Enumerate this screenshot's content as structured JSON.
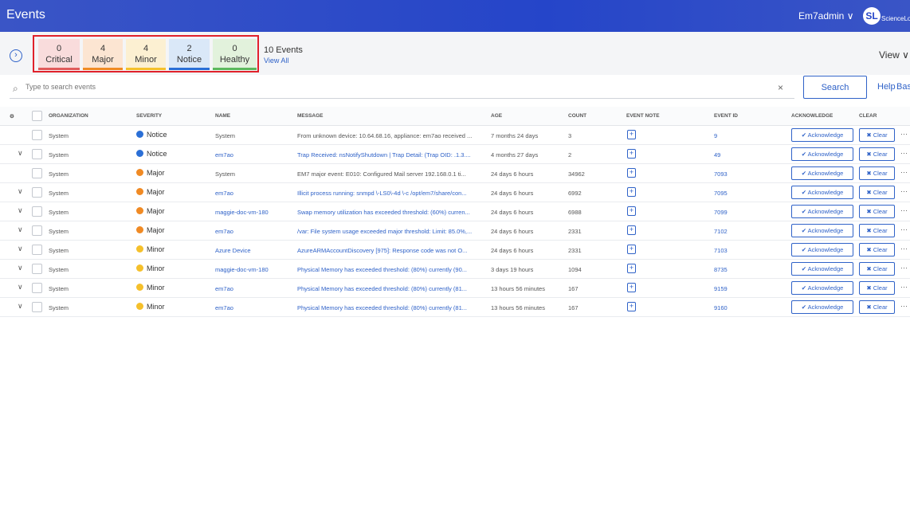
{
  "header": {
    "title": "Events",
    "user": "Em7admin",
    "user_chevron": "∨",
    "logo_mark": "SL",
    "logo_text": "ScienceLogic"
  },
  "summary": {
    "tiles": [
      {
        "count": "0",
        "label": "Critical",
        "color": "#e05a5a",
        "bg": "#f9dcdc"
      },
      {
        "count": "4",
        "label": "Major",
        "color": "#f08a24",
        "bg": "#fce5d2"
      },
      {
        "count": "4",
        "label": "Minor",
        "color": "#f5c02b",
        "bg": "#fcf0d2"
      },
      {
        "count": "2",
        "label": "Notice",
        "color": "#2b6fd6",
        "bg": "#dae8f8"
      },
      {
        "count": "0",
        "label": "Healthy",
        "color": "#5cb85c",
        "bg": "#e2f2dc"
      }
    ],
    "total": "10 Events",
    "view_all": "View All",
    "view_menu": "View ∨",
    "expand_icon": "›"
  },
  "search": {
    "placeholder": "Type to search events",
    "button": "Search",
    "clear": "×",
    "help": "Help",
    "basic": "Basi"
  },
  "columns": {
    "organization": "ORGANIZATION",
    "severity": "SEVERITY",
    "name": "NAME",
    "message": "MESSAGE",
    "age": "AGE",
    "count": "COUNT",
    "event_note": "EVENT NOTE",
    "event_id": "EVENT ID",
    "acknowledge": "ACKNOWLEDGE",
    "clear": "CLEAR"
  },
  "icons": {
    "gear": "⚙",
    "chevron": "∨",
    "note": "+",
    "ack": "✔",
    "clear": "✖",
    "more": "···"
  },
  "actions": {
    "acknowledge": "Acknowledge",
    "clear": "Clear"
  },
  "severity_colors": {
    "Notice": "#2b6fd6",
    "Major": "#f08a24",
    "Minor": "#f5c02b"
  },
  "rows": [
    {
      "expandable": false,
      "org": "System",
      "severity": "Notice",
      "name": "System",
      "name_link": false,
      "message": "From unknown device: 10.64.68.16, appliance: em7ao received ...",
      "message_link": false,
      "age": "7 months 24 days",
      "count": "3",
      "event_id": "9"
    },
    {
      "expandable": true,
      "org": "System",
      "severity": "Notice",
      "name": "em7ao",
      "name_link": true,
      "message": "Trap Received: nsNotifyShutdown | Trap Detail: (Trap OID: .1.3....",
      "message_link": true,
      "age": "4 months 27 days",
      "count": "2",
      "event_id": "49"
    },
    {
      "expandable": false,
      "org": "System",
      "severity": "Major",
      "name": "System",
      "name_link": false,
      "message": "EM7 major event: E010: Configured Mail server 192.168.0.1 ti...",
      "message_link": false,
      "age": "24 days 6 hours",
      "count": "34962",
      "event_id": "7093"
    },
    {
      "expandable": true,
      "org": "System",
      "severity": "Major",
      "name": "em7ao",
      "name_link": true,
      "message": "Illicit process running: snmpd \\-LS0\\-4d \\-c /opt/em7/share/con...",
      "message_link": true,
      "age": "24 days 6 hours",
      "count": "6992",
      "event_id": "7095"
    },
    {
      "expandable": true,
      "org": "System",
      "severity": "Major",
      "name": "maggie-doc-vm-180",
      "name_link": true,
      "message": "Swap memory utilization has exceeded threshold: (60%) curren...",
      "message_link": true,
      "age": "24 days 6 hours",
      "count": "6988",
      "event_id": "7099"
    },
    {
      "expandable": true,
      "org": "System",
      "severity": "Major",
      "name": "em7ao",
      "name_link": true,
      "message": "/var: File system usage exceeded major threshold: Limit: 85.0%,...",
      "message_link": true,
      "age": "24 days 6 hours",
      "count": "2331",
      "event_id": "7102"
    },
    {
      "expandable": true,
      "org": "System",
      "severity": "Minor",
      "name": "Azure Device",
      "name_link": true,
      "message": "AzureARMAccountDiscovery [975]: Response code was not O...",
      "message_link": true,
      "age": "24 days 6 hours",
      "count": "2331",
      "event_id": "7103"
    },
    {
      "expandable": true,
      "org": "System",
      "severity": "Minor",
      "name": "maggie-doc-vm-180",
      "name_link": true,
      "message": "Physical Memory has exceeded threshold: (80%) currently (90...",
      "message_link": true,
      "age": "3 days 19 hours",
      "count": "1094",
      "event_id": "8735"
    },
    {
      "expandable": true,
      "org": "System",
      "severity": "Minor",
      "name": "em7ao",
      "name_link": true,
      "message": "Physical Memory has exceeded threshold: (80%) currently (81...",
      "message_link": true,
      "age": "13 hours 56 minutes",
      "count": "167",
      "event_id": "9159"
    },
    {
      "expandable": true,
      "org": "System",
      "severity": "Minor",
      "name": "em7ao",
      "name_link": true,
      "message": "Physical Memory has exceeded threshold: (80%) currently (81...",
      "message_link": true,
      "age": "13 hours 56 minutes",
      "count": "167",
      "event_id": "9160"
    }
  ]
}
